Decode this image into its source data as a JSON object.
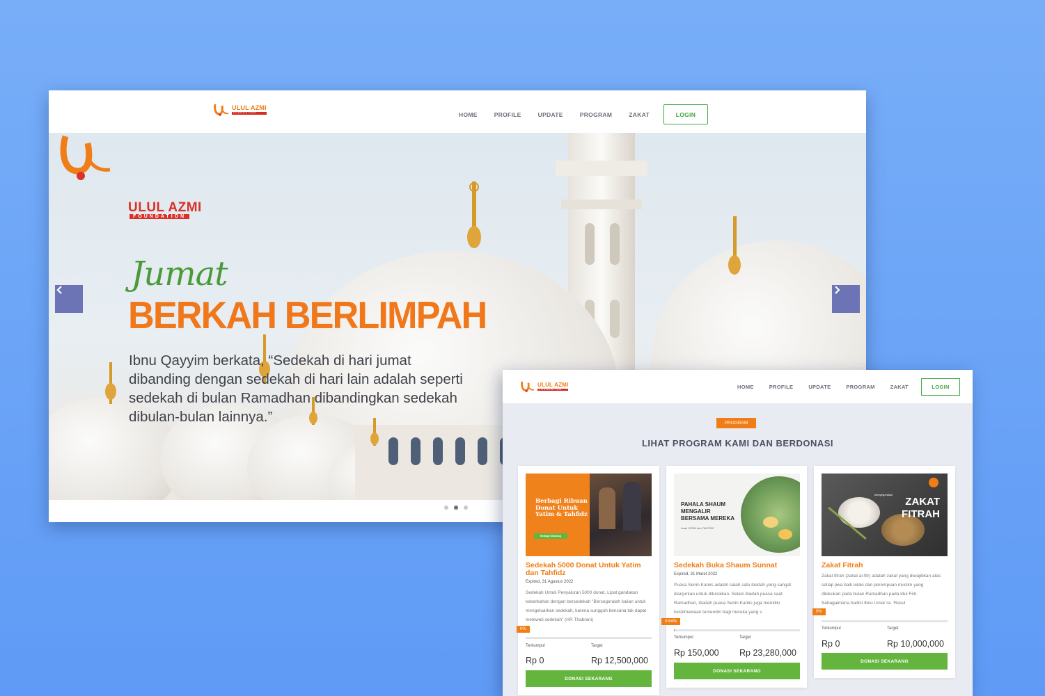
{
  "brand": {
    "name": "ULUL AZMI",
    "sub": "FOUNDATION",
    "orange": "#f07d16",
    "red": "#d8322a",
    "green": "#64b53e"
  },
  "nav": {
    "items": [
      "HOME",
      "PROFILE",
      "UPDATE",
      "PROGRAM",
      "ZAKAT"
    ],
    "login": "LOGIN"
  },
  "hero": {
    "script": "Jumat",
    "headline": "BERKAH BERLIMPAH",
    "quote": "Ibnu Qayyim berkata, “Sedekah di hari jumat dibanding dengan sedekah di hari lain adalah seperti sedekah di bulan Ramadhan dibandingkan sedekah dibulan-bulan lainnya.”",
    "prev_icon": "chevron-left-icon",
    "next_icon": "chevron-right-icon",
    "slides": 3,
    "active_slide": 2
  },
  "program": {
    "pill": "PROGRAM",
    "title": "LIHAT PROGRAM KAMI DAN BERDONASI",
    "collected_label": "Terkumpul",
    "target_label": "Target",
    "donate_label": "DONASI SEKARANG",
    "cards": [
      {
        "title": "Sedekah 5000 Donat Untuk Yatim dan Tahfidz",
        "date": "Expired, 31 Agustus 2022",
        "desc": "Sedekah Untuk Penyaluran 5000 donat, Lipat gandakan keberkahan dengan bersedekah \"Bersegeralah kalian untuk mengeluarkan sedekah, karena sungguh bencana tak dapat melewati sedekah\" (HR Thabrani)",
        "progress": "0%",
        "collected": "Rp 0",
        "target": "Rp 12,500,000",
        "image_text": "Berbagi Ribuan Donat Untuk Yatim & Tahfidz",
        "image_button": "Berbagi Sekarang"
      },
      {
        "title": "Sedekah Buka Shaum Sunnat",
        "date": "Expired, 31 Maret 2022",
        "desc": "Puasa Senin Kamis adalah salah satu ibadah yang sangat dianjurkan untuk ditunaikan. Selain ibadah puasa saat Ramadhan, ibadah puasa Senin Kamis juga memiliki keistimewaan tersendiri bagi mereka yang s",
        "progress": "0.64%",
        "collected": "Rp 150,000",
        "target": "Rp 23,280,000",
        "image_text": "PAHALA SHAUM MENGALIR BERSAMA MEREKA",
        "image_sub": "Anak YATIM dan TAHFIDZ"
      },
      {
        "title": "Zakat Fitrah",
        "date": "",
        "desc": "Zakat fitrah (zakat al-fitr) adalah zakat yang diwajibkan atas setiap jiwa baik lelaki dan perempuan muslim yang dilakukan pada bulan Ramadhan pada Idul Fitri. Sebagaimana hadist Ibnu Umar ra. 'Rasul",
        "progress": "0%",
        "collected": "Rp 0",
        "target": "Rp 10,000,000",
        "image_small": "Menyegerakan",
        "image_text": "ZAKAT FITRAH"
      }
    ]
  }
}
